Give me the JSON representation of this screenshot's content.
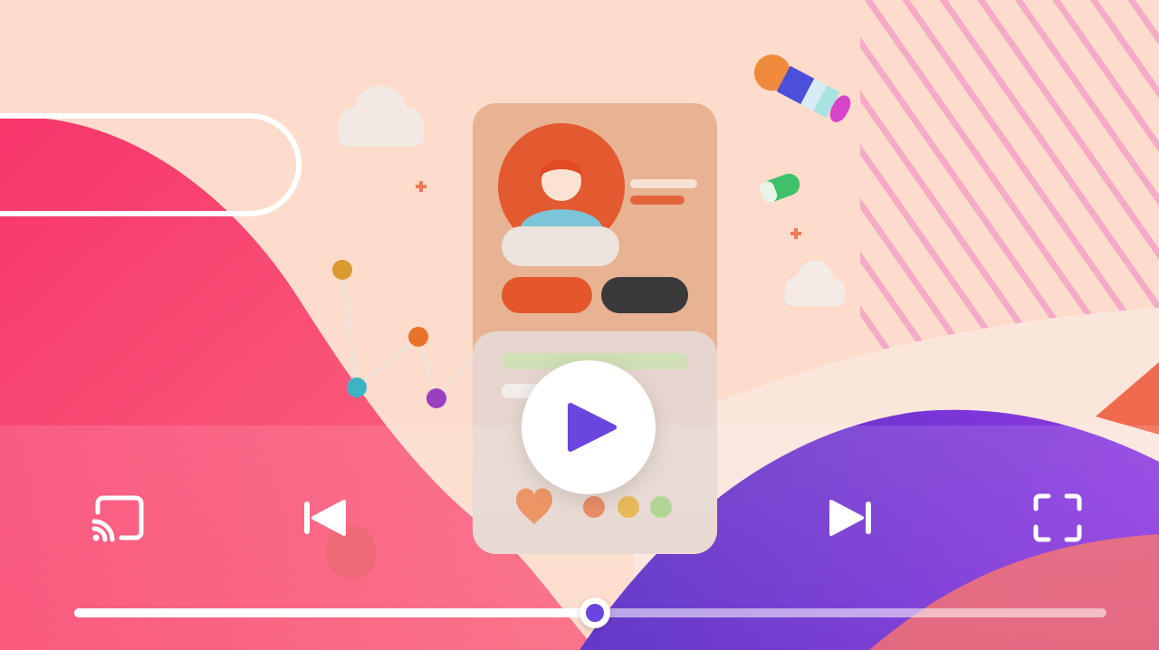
{
  "player": {
    "colors": {
      "accent": "#6b45e0",
      "background": "#fddccb",
      "wave_pink": "#f7406d",
      "wave_purple": "#6f2fd6"
    },
    "controls": {
      "play_icon": "play-icon",
      "cast_icon": "cast-icon",
      "previous_icon": "skip-previous-icon",
      "next_icon": "skip-next-icon",
      "fullscreen_icon": "fullscreen-icon"
    },
    "progress": {
      "played_fraction": 0.504
    }
  }
}
